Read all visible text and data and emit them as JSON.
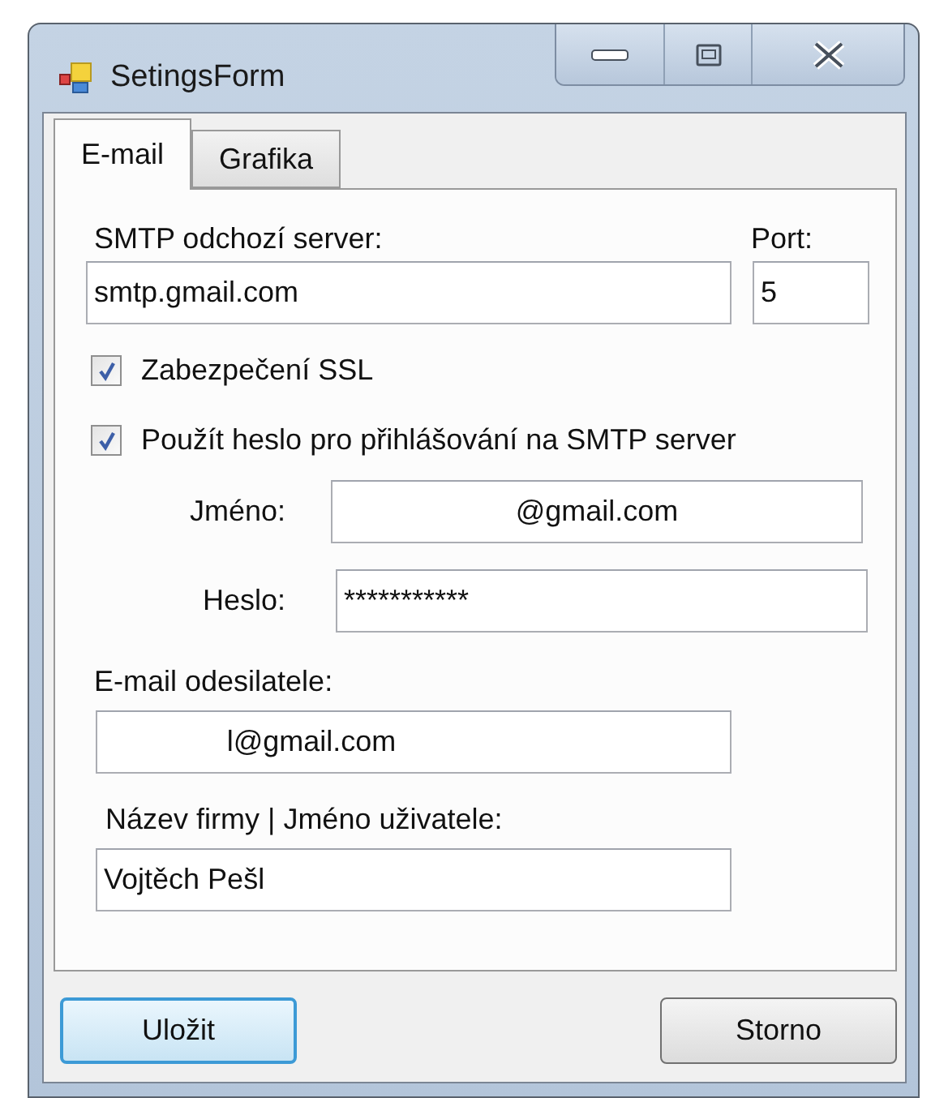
{
  "window": {
    "title": "SetingsForm"
  },
  "tabs": [
    {
      "label": "E-mail",
      "selected": true
    },
    {
      "label": "Grafika",
      "selected": false
    }
  ],
  "smtp": {
    "label": "SMTP odchozí server:",
    "value": "smtp.gmail.com"
  },
  "port": {
    "label": "Port:",
    "value": "5"
  },
  "checkboxes": [
    {
      "label": "Zabezpečení SSL",
      "checked": true
    },
    {
      "label": "Použít heslo pro přihlášování na SMTP server",
      "checked": true
    }
  ],
  "credentials": [
    {
      "label": "Jméno:",
      "value": "@gmail.com",
      "kind": "text"
    },
    {
      "label": "Heslo:",
      "value": "***********",
      "kind": "password"
    }
  ],
  "sender": {
    "label": "E-mail odesilatele:",
    "value": "l@gmail.com"
  },
  "company": {
    "label": "Název firmy | Jméno uživatele:",
    "value": "Vojtěch Pešl"
  },
  "buttons": [
    {
      "label": "Uložit",
      "default": true
    },
    {
      "label": "Storno",
      "default": false
    }
  ]
}
